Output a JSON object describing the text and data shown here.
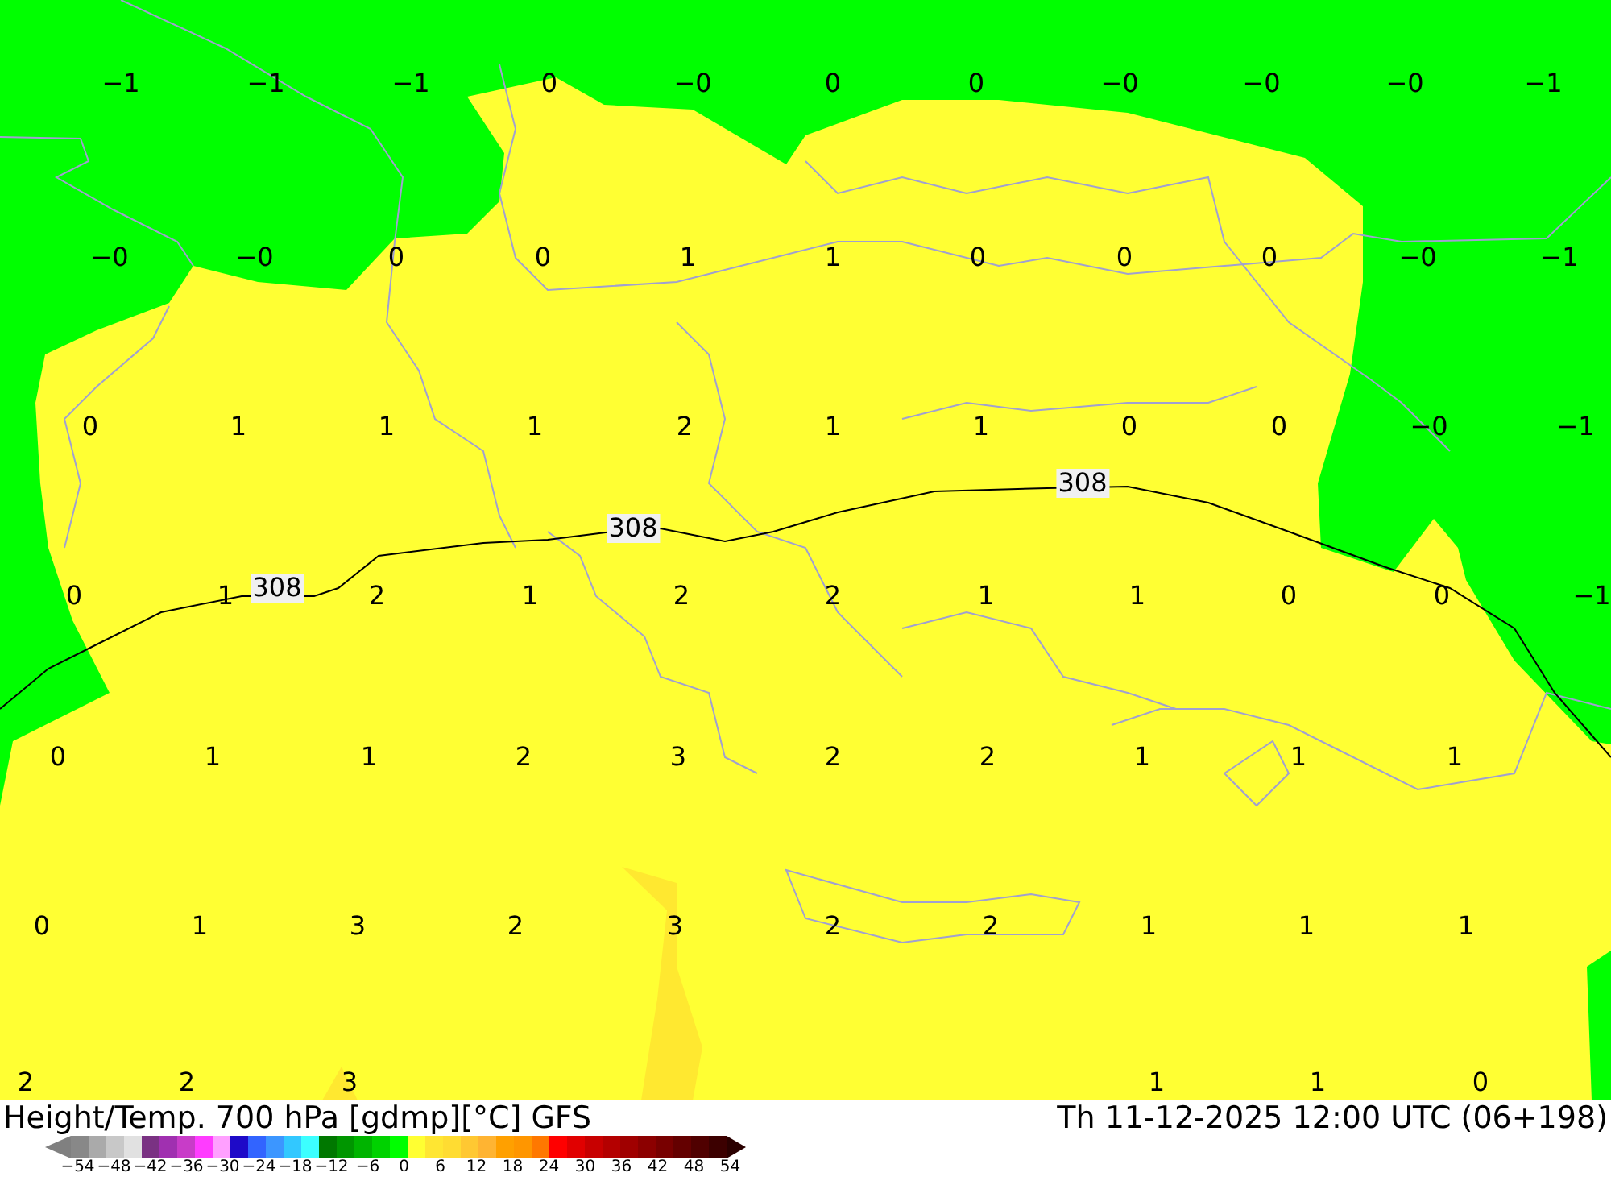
{
  "map": {
    "temperature_labels": [
      [
        "−1",
        "−1",
        "−1",
        "0",
        "−0",
        "0",
        "0",
        "−0",
        "−0",
        "−0",
        "−1"
      ],
      [
        "−0",
        "−0",
        "0",
        "0",
        "1",
        "1",
        "0",
        "0",
        "0",
        "−0",
        "−1"
      ],
      [
        "0",
        "1",
        "1",
        "1",
        "2",
        "1",
        "1",
        "0",
        "0",
        "−0",
        "−1"
      ],
      [
        "0",
        "1",
        "2",
        "1",
        "2",
        "2",
        "1",
        "1",
        "0",
        "0",
        "−1"
      ],
      [
        "0",
        "1",
        "1",
        "2",
        "3",
        "2",
        "2",
        "1",
        "1",
        "1"
      ],
      [
        "0",
        "1",
        "3",
        "2",
        "3",
        "2",
        "2",
        "1",
        "1",
        "1"
      ],
      [
        "2",
        "2",
        "3",
        "1",
        "1",
        "0"
      ]
    ],
    "contour_labels": [
      "308",
      "308",
      "308"
    ]
  },
  "footer": {
    "title": "Height/Temp. 700 hPa [gdmp][°C] GFS",
    "valid_time": "Th 11-12-2025 12:00 UTC (06+198)",
    "colorbar": {
      "swatches": [
        {
          "color": "#888888"
        },
        {
          "color": "#aaaaaa"
        },
        {
          "color": "#c8c8c8"
        },
        {
          "color": "#e1e1e1"
        },
        {
          "color": "#7a3283"
        },
        {
          "color": "#a030b0"
        },
        {
          "color": "#c83cc8"
        },
        {
          "color": "#ff3cff"
        },
        {
          "color": "#ffa0ff"
        },
        {
          "color": "#1e0ac8"
        },
        {
          "color": "#3264ff"
        },
        {
          "color": "#3c96ff"
        },
        {
          "color": "#32c8ff"
        },
        {
          "color": "#3cffff"
        },
        {
          "color": "#007800"
        },
        {
          "color": "#009600"
        },
        {
          "color": "#00b400"
        },
        {
          "color": "#00d200"
        },
        {
          "color": "#00ff00"
        },
        {
          "color": "#ffff32"
        },
        {
          "color": "#ffe632"
        },
        {
          "color": "#ffdc32"
        },
        {
          "color": "#ffc832"
        },
        {
          "color": "#ffb432"
        },
        {
          "color": "#ffa000"
        },
        {
          "color": "#ff9600"
        },
        {
          "color": "#ff7800"
        },
        {
          "color": "#ff0000"
        },
        {
          "color": "#e10000"
        },
        {
          "color": "#c80000"
        },
        {
          "color": "#b40000"
        },
        {
          "color": "#a00000"
        },
        {
          "color": "#8c0000"
        },
        {
          "color": "#780000"
        },
        {
          "color": "#640000"
        },
        {
          "color": "#500000"
        },
        {
          "color": "#3c0000"
        }
      ],
      "ticks": [
        "−54",
        "−48",
        "−42",
        "−36",
        "−30",
        "−24",
        "−18",
        "−12",
        "−6",
        "0",
        "6",
        "12",
        "18",
        "24",
        "30",
        "36",
        "42",
        "48",
        "54"
      ]
    }
  }
}
